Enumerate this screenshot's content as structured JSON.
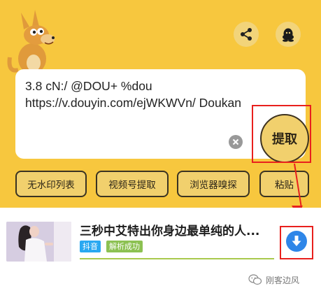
{
  "share_text": "3.8 cN:/ @DOU+ %dou\nhttps://v.douyin.com/ejWKWVn/ Doukan",
  "buttons": {
    "extract": "提取",
    "no_watermark_list": "无水印列表",
    "video_account_extract": "视频号提取",
    "browser_sniff": "浏览器嗅探",
    "paste": "粘贴"
  },
  "icons": {
    "share": "share-icon",
    "qq": "qq-icon",
    "clear": "close-icon",
    "download": "download-icon",
    "mascot": "kangaroo-mascot"
  },
  "result": {
    "title": "三秒中艾特出你身边最单纯的人...",
    "platform_badge": "抖音",
    "status_badge": "解析成功"
  },
  "watermark": "刚客边风",
  "colors": {
    "background_yellow": "#f7c73e",
    "button_yellow": "#f1d06d",
    "highlight_red": "#e8201d",
    "download_blue": "#2e86e8",
    "platform_badge_blue": "#29a8f1",
    "status_badge_green": "#8cc152"
  }
}
